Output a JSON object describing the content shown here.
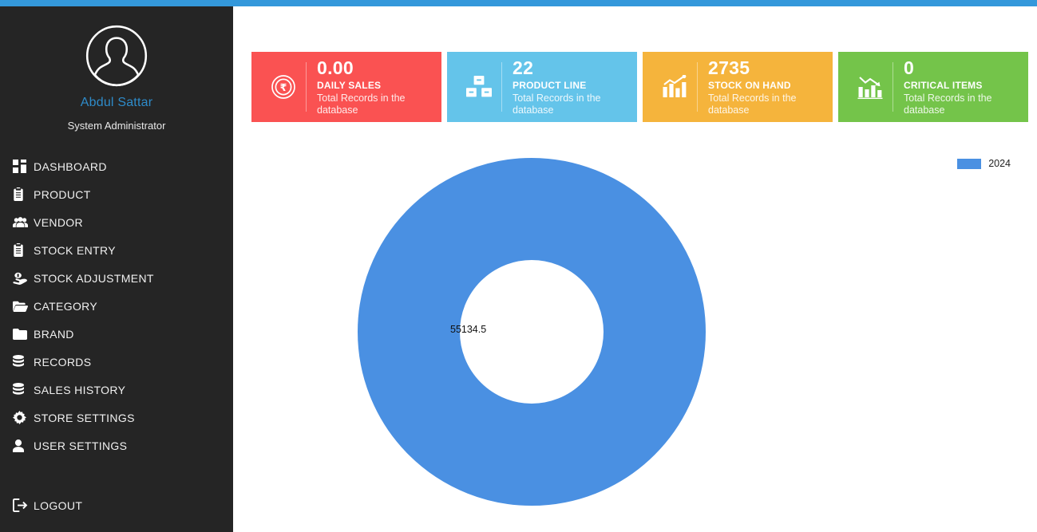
{
  "theme": {
    "accent_blue": "#3498db",
    "sidebar_bg": "#252525",
    "username_color": "#2e8bc9",
    "chart_blue": "#4a90e2"
  },
  "sidebar": {
    "user": {
      "avatar_icon": "user-avatar-icon",
      "name": "Abdul Sattar",
      "role": "System Administrator"
    },
    "items": [
      {
        "label": "DASHBOARD",
        "icon": "dashboard-icon"
      },
      {
        "label": "PRODUCT",
        "icon": "clipboard-icon"
      },
      {
        "label": "VENDOR",
        "icon": "users-icon"
      },
      {
        "label": "STOCK ENTRY",
        "icon": "clipboard-icon"
      },
      {
        "label": "STOCK ADJUSTMENT",
        "icon": "hand-holding-icon"
      },
      {
        "label": "CATEGORY",
        "icon": "folder-open-icon"
      },
      {
        "label": "BRAND",
        "icon": "folder-icon"
      },
      {
        "label": "RECORDS",
        "icon": "database-icon"
      },
      {
        "label": "SALES HISTORY",
        "icon": "database-icon"
      },
      {
        "label": "STORE SETTINGS",
        "icon": "gear-icon"
      },
      {
        "label": "USER SETTINGS",
        "icon": "user-icon"
      }
    ],
    "logout": {
      "label": "LOGOUT",
      "icon": "sign-out-icon"
    }
  },
  "cards": [
    {
      "value": "0.00",
      "title": "DAILY SALES",
      "subtitle": "Total Records in the database",
      "color": "#fa5252",
      "icon": "rupee-circle-icon"
    },
    {
      "value": "22",
      "title": "PRODUCT LINE",
      "subtitle": "Total Records in the database",
      "color": "#64c4ea",
      "icon": "boxes-icon"
    },
    {
      "value": "2735",
      "title": "STOCK ON HAND",
      "subtitle": "Total Records in the database",
      "color": "#f5b43c",
      "icon": "chart-line-up-icon"
    },
    {
      "value": "0",
      "title": "CRITICAL ITEMS",
      "subtitle": "Total Records in the database",
      "color": "#74c44a",
      "icon": "chart-line-down-icon"
    }
  ],
  "chart_data": {
    "type": "pie",
    "variant": "donut",
    "title": "",
    "legend": [
      {
        "name": "2024",
        "color": "#4a90e2"
      }
    ],
    "legend_position": "top-right",
    "labels": [
      "2024"
    ],
    "values": [
      55134.5
    ],
    "data_labels": [
      "55134.5"
    ],
    "total": 55134.5,
    "hole_ratio": 0.43
  }
}
